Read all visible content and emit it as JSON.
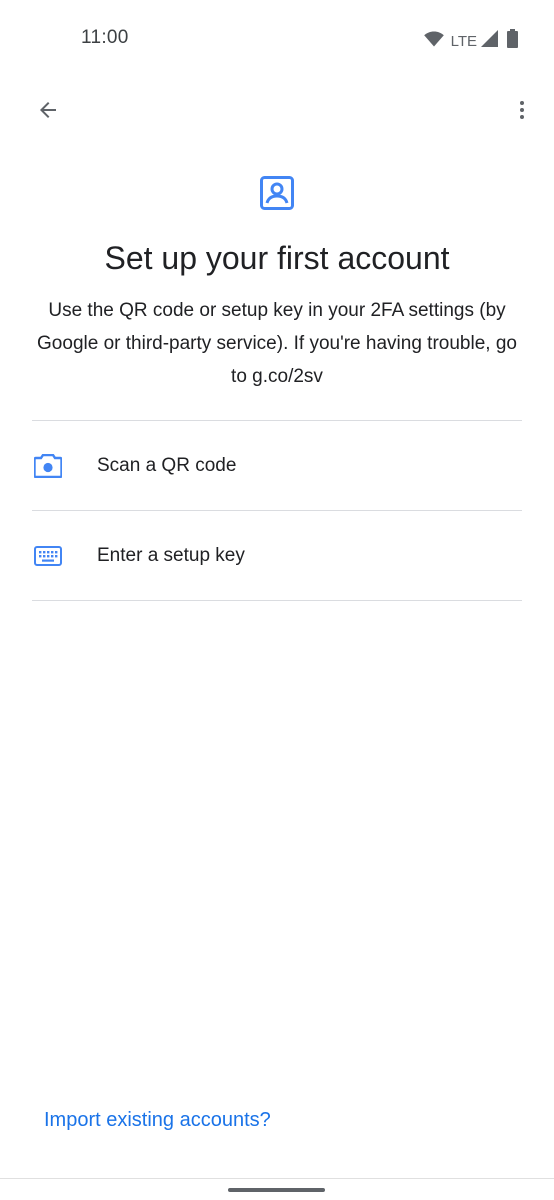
{
  "status_bar": {
    "time": "11:00",
    "network_label": "LTE",
    "icons": [
      "wifi-icon",
      "cell-signal-icon",
      "battery-icon"
    ]
  },
  "app_bar": {
    "back_icon": "arrow-back-icon",
    "more_icon": "more-vert-icon"
  },
  "header": {
    "icon": "account-box-icon",
    "title": "Set up your first account",
    "description": "Use the QR code or setup key in your 2FA settings (by Google or third-party service). If you're having trouble, go to g.co/2sv"
  },
  "options": [
    {
      "icon": "camera-icon",
      "label": "Scan a QR code"
    },
    {
      "icon": "keyboard-icon",
      "label": "Enter a setup key"
    }
  ],
  "footer": {
    "import_link": "Import existing accounts?"
  },
  "colors": {
    "accent": "#1a73e8",
    "icon_blue": "#4285f4",
    "text_primary": "#202124",
    "divider": "#dadce0",
    "icon_gray": "#5f6368"
  }
}
